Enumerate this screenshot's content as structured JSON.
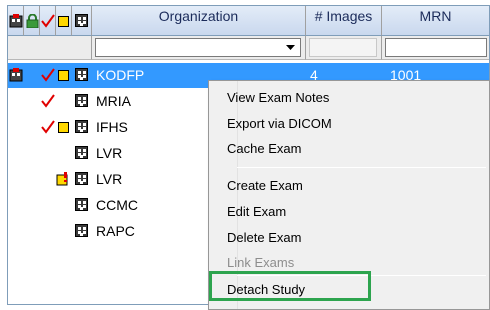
{
  "columns": {
    "organization": "Organization",
    "images": "# Images",
    "mrn": "MRN"
  },
  "rows": [
    {
      "organization": "KODFP",
      "images": "4",
      "mrn": "1001",
      "alert": true,
      "check": true,
      "square": true,
      "selected": true
    },
    {
      "organization": "MRIA",
      "images": "",
      "mrn": "",
      "alert": false,
      "check": true,
      "square": false,
      "selected": false
    },
    {
      "organization": "IFHS",
      "images": "",
      "mrn": "",
      "alert": false,
      "check": true,
      "square": true,
      "selected": false
    },
    {
      "organization": "LVR",
      "images": "",
      "mrn": "",
      "alert": false,
      "check": false,
      "square": false,
      "selected": false
    },
    {
      "organization": "LVR",
      "images": "",
      "mrn": "",
      "alert": false,
      "check": false,
      "square": false,
      "flag": true,
      "selected": false
    },
    {
      "organization": "CCMC",
      "images": "",
      "mrn": "",
      "alert": false,
      "check": false,
      "square": false,
      "selected": false
    },
    {
      "organization": "RAPC",
      "images": "",
      "mrn": "",
      "alert": false,
      "check": false,
      "square": false,
      "selected": false
    }
  ],
  "context_menu": {
    "items": [
      {
        "label": "View Exam Notes",
        "enabled": true
      },
      {
        "label": "Export via DICOM",
        "enabled": true
      },
      {
        "label": "Cache Exam",
        "enabled": true
      },
      {
        "label": "Create Exam",
        "enabled": true
      },
      {
        "label": "Edit Exam",
        "enabled": true
      },
      {
        "label": "Delete Exam",
        "enabled": true
      },
      {
        "label": "Link Exams",
        "enabled": false
      },
      {
        "label": "Detach Study",
        "enabled": true
      }
    ]
  },
  "colors": {
    "selection": "#3399ff",
    "highlight_box": "#2da44e",
    "check": "#e00000",
    "square": "#ffd800"
  },
  "icons": [
    "alert-icon",
    "lock-icon",
    "check-icon",
    "square-icon",
    "building-icon"
  ]
}
